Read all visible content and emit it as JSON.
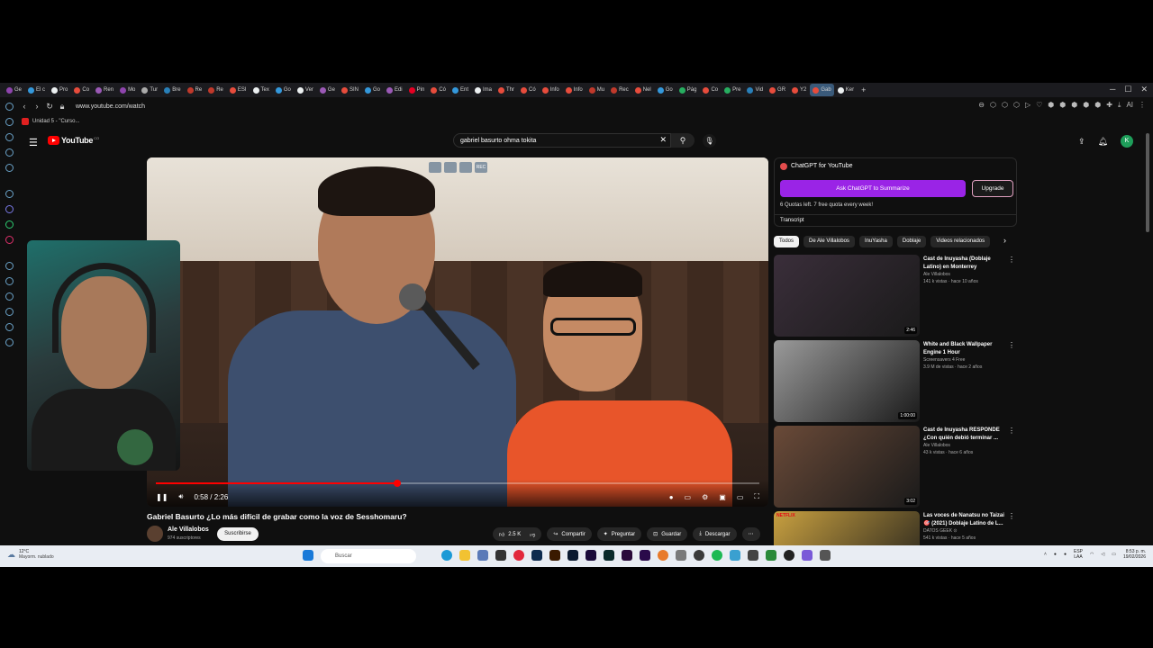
{
  "browser": {
    "tabs": [
      {
        "label": "Ge",
        "color": "#8e44ad"
      },
      {
        "label": "El c",
        "color": "#3498db"
      },
      {
        "label": "Pro",
        "color": "#ecf0f1"
      },
      {
        "label": "Co",
        "color": "#e74c3c"
      },
      {
        "label": "Ren",
        "color": "#9b59b6"
      },
      {
        "label": "Mo",
        "color": "#8e44ad"
      },
      {
        "label": "Tur",
        "color": "#aaa"
      },
      {
        "label": "Bre",
        "color": "#2980b9"
      },
      {
        "label": "Re",
        "color": "#c0392b"
      },
      {
        "label": "Re",
        "color": "#c0392b"
      },
      {
        "label": "ESI",
        "color": "#e74c3c"
      },
      {
        "label": "Tex",
        "color": "#ecf0f1"
      },
      {
        "label": "Go",
        "color": "#3498db"
      },
      {
        "label": "Ver",
        "color": "#ecf0f1"
      },
      {
        "label": "Ge",
        "color": "#9b59b6"
      },
      {
        "label": "SIN",
        "color": "#e74c3c"
      },
      {
        "label": "Go",
        "color": "#3498db"
      },
      {
        "label": "Edi",
        "color": "#9b59b6"
      },
      {
        "label": "Pin",
        "color": "#e60023"
      },
      {
        "label": "Có",
        "color": "#e74c3c"
      },
      {
        "label": "Ent",
        "color": "#3498db"
      },
      {
        "label": "Ima",
        "color": "#ecf0f1"
      },
      {
        "label": "Thr",
        "color": "#e74c3c"
      },
      {
        "label": "Có",
        "color": "#e74c3c"
      },
      {
        "label": "Info",
        "color": "#e74c3c"
      },
      {
        "label": "Info",
        "color": "#e74c3c"
      },
      {
        "label": "Mu",
        "color": "#c0392b"
      },
      {
        "label": "Rec",
        "color": "#c0392b"
      },
      {
        "label": "Nel",
        "color": "#e74c3c"
      },
      {
        "label": "Go",
        "color": "#3498db"
      },
      {
        "label": "Pág",
        "color": "#27ae60"
      },
      {
        "label": "Co",
        "color": "#e74c3c"
      },
      {
        "label": "Pre",
        "color": "#27ae60"
      },
      {
        "label": "Vid",
        "color": "#2980b9"
      },
      {
        "label": "GR",
        "color": "#e74c3c"
      },
      {
        "label": "Y2",
        "color": "#e74c3c"
      },
      {
        "label": "Gab",
        "color": "#e74c3c",
        "active": true
      },
      {
        "label": "Ker",
        "color": "#ecf0f1"
      }
    ],
    "url": "www.youtube.com/watch",
    "bookmark": "Unidad 5 - \"Curso..."
  },
  "youtube": {
    "logo_text": "YouTube",
    "logo_region": "CO",
    "search_query": "gabriel basurto ohma tokita",
    "avatar_letter": "K",
    "video": {
      "time": "0:58 / 2:26",
      "progress": 0.4,
      "ext_buttons": [
        "",
        "",
        "",
        "REC"
      ]
    },
    "title": "Gabriel Basurto ¿Lo más difícil de grabar como la voz de Sesshomaru?",
    "channel": {
      "name": "Ale Villalobos",
      "subs": "974 suscriptores",
      "subscribe": "Suscribirse"
    },
    "actions": {
      "likes": "2.5 K",
      "share": "Compartir",
      "ask": "Preguntar",
      "save": "Guardar",
      "download": "Descargar"
    },
    "gpt": {
      "title": "ChatGPT for YouTube",
      "ask": "Ask ChatGPT to Summarize",
      "upgrade": "Upgrade",
      "quota": "6 Quotas left. 7 free quota every week!",
      "transcript": "Transcript"
    },
    "chips": [
      "Todos",
      "De Ale Villalobos",
      "InuYasha",
      "Doblaje",
      "Videos relacionados"
    ],
    "recommendations": [
      {
        "title": "Cast de Inuyasha (Doblaje Latino) en Monterrey",
        "channel": "Ale Villalobos",
        "meta": "141 k vistas · hace 10 años",
        "duration": "2:46",
        "thumb": "#3a2e3a"
      },
      {
        "title": "White and Black Wallpaper Engine 1 Hour",
        "channel": "Screensavers 4 Free",
        "meta": "3.9 M de vistas · hace 2 años",
        "duration": "1:00:00",
        "thumb": "#9a9a9a"
      },
      {
        "title": "Cast de Inuyasha RESPONDE ¿Con quién debió terminar ...",
        "channel": "Ale Villalobos",
        "meta": "43 k vistas · hace 6 años",
        "duration": "3:02",
        "thumb": "#6a4a38"
      },
      {
        "title": "Las voces de Nanatsu no Taizai 🎯 (2021) Doblaje Latino de L...",
        "channel": "DATOS GEEK ⊙",
        "meta": "541 k vistas · hace 5 años",
        "duration": "",
        "thumb": "#c8a040",
        "badge": "NETFLIX"
      }
    ]
  },
  "taskbar": {
    "weather_temp": "12°C",
    "weather_desc": "Mayorm. nublado",
    "search": "Buscar",
    "lang": "ESP",
    "lang2": "LAA",
    "time": "8:53 p. m.",
    "date": "19/02/2026"
  }
}
